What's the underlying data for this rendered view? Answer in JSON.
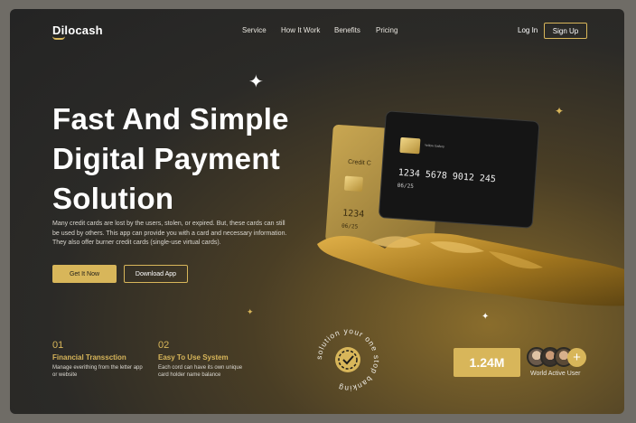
{
  "nav": {
    "logo": "Dilocash",
    "links": [
      "Service",
      "How It Work",
      "Benefits",
      "Pricing"
    ],
    "login": "Log In",
    "signup": "Sign Up"
  },
  "hero": {
    "headline_lines": [
      "Fast And Simple",
      "Digital Payment",
      "Solution"
    ],
    "description": "Many credit cards are lost by the users, stolen, or expired. But, these cards can still be used by others. This app can provide you with a card and necessary information. They also offer burner credit cards (single-use virtual cards).",
    "primary_button": "Get It Now",
    "secondary_button": "Download App"
  },
  "features": [
    {
      "number": "01",
      "title": "Financial Transsction",
      "desc": "Manage everithing from the letter app or website"
    },
    {
      "number": "02",
      "title": "Easy To Use System",
      "desc": "Each  cord can have its own unique card holder name balance"
    }
  ],
  "cards": {
    "front_number": "1234  5678  9012  245",
    "front_expiry": "06/25",
    "back_label": "Credit C",
    "back_number": "1234",
    "back_expiry": "06/25",
    "chip_text": "Yellow Gallery"
  },
  "badge_text": "solution your one stop banking",
  "stats": {
    "value": "1.24M",
    "label": "World Active User",
    "plus": "+"
  },
  "colors": {
    "accent": "#d8b65a",
    "background": "#262624",
    "text": "#ffffff"
  }
}
